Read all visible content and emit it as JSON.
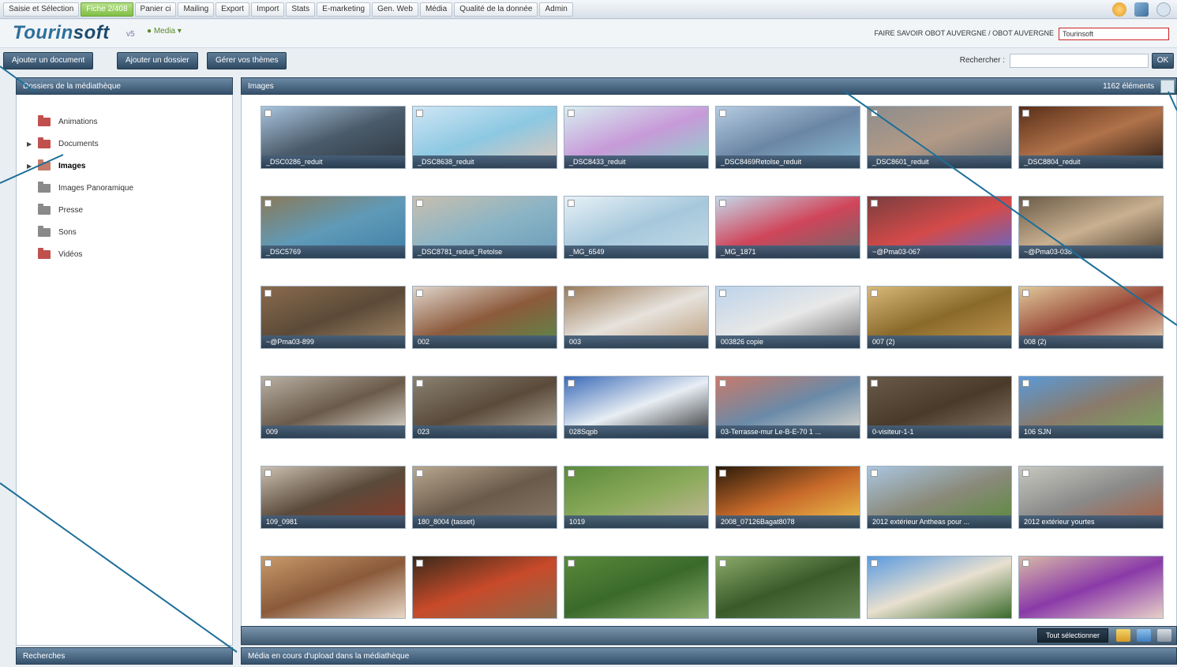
{
  "menubar": {
    "items": [
      "Saisie et Sélection",
      "Fiche 2/408",
      "Panier ci",
      "Mailing",
      "Export",
      "Import",
      "Stats",
      "E-marketing",
      "Gen. Web",
      "Média",
      "Qualité de la donnée",
      "Admin"
    ]
  },
  "brand": {
    "logo_main": "Tourin",
    "logo_soft": "soft",
    "version": "v5",
    "home": "Media",
    "context": "FAIRE SAVOIR OBOT AUVERGNE / OBOT AUVERGNE",
    "context_select": "Tourinsoft"
  },
  "actions": {
    "add_document": "Ajouter un document",
    "add_folder": "Ajouter un dossier",
    "manage_themes": "Gérer vos thèmes",
    "search_label": "Rechercher :",
    "search_value": "",
    "ok": "OK"
  },
  "left_panel": {
    "title": "Dossiers de la médiathèque",
    "folders": [
      {
        "label": "Animations",
        "has_children": false,
        "selected": false,
        "color": "#c0504d"
      },
      {
        "label": "Documents",
        "has_children": true,
        "selected": false,
        "color": "#c0504d"
      },
      {
        "label": "Images",
        "has_children": true,
        "selected": true,
        "color": "#c47b6a"
      },
      {
        "label": "Images Panoramique",
        "has_children": false,
        "selected": false,
        "color": "#8a8a8a"
      },
      {
        "label": "Presse",
        "has_children": false,
        "selected": false,
        "color": "#8a8a8a"
      },
      {
        "label": "Sons",
        "has_children": false,
        "selected": false,
        "color": "#8a8a8a"
      },
      {
        "label": "Vidéos",
        "has_children": false,
        "selected": false,
        "color": "#c0504d"
      }
    ]
  },
  "main_panel": {
    "title": "Images",
    "count": "1162 éléments",
    "tiles": [
      {
        "caption": "_DSC0286_reduit",
        "colors": [
          "#a9c4de",
          "#4a5b6a",
          "#2e3640"
        ]
      },
      {
        "caption": "_DSC8638_reduit",
        "colors": [
          "#cfe6f4",
          "#8cc8e2",
          "#e5c9b9"
        ]
      },
      {
        "caption": "_DSC8433_reduit",
        "colors": [
          "#d8eef0",
          "#c79ad8",
          "#8ad4c9"
        ]
      },
      {
        "caption": "_DSC8469Retolse_reduit",
        "colors": [
          "#b5cbe0",
          "#6b86a5",
          "#8cbfd6"
        ]
      },
      {
        "caption": "_DSC8601_reduit",
        "colors": [
          "#8d8d8d",
          "#b29a86",
          "#6c6e72"
        ]
      },
      {
        "caption": "_DSC8804_reduit",
        "colors": [
          "#5a2f18",
          "#b0724a",
          "#2b1a10"
        ]
      },
      {
        "caption": "_DSC5769",
        "colors": [
          "#8a7a5a",
          "#5f9ab8",
          "#3f7fa6"
        ]
      },
      {
        "caption": "_DSC8781_reduit_Retolse",
        "colors": [
          "#c8bfae",
          "#8bb4c5",
          "#6b9cb8"
        ]
      },
      {
        "caption": "_MG_6549",
        "colors": [
          "#e8f1f6",
          "#a6c8dc",
          "#c5dce8"
        ]
      },
      {
        "caption": "_MG_1871",
        "colors": [
          "#c5d8ea",
          "#d0455a",
          "#6a6a6a"
        ]
      },
      {
        "caption": "~@Pma03-067",
        "colors": [
          "#7a3e3e",
          "#d44a4a",
          "#5a6ad0"
        ]
      },
      {
        "caption": "~@Pma03-038",
        "colors": [
          "#6b5b48",
          "#c9b090",
          "#4d3d2d"
        ]
      },
      {
        "caption": "~@Pma03-899",
        "colors": [
          "#8a6b4d",
          "#5b4a38",
          "#a78a6a"
        ]
      },
      {
        "caption": "002",
        "colors": [
          "#e0d6cc",
          "#8c5a3c",
          "#5a8a4a"
        ]
      },
      {
        "caption": "003",
        "colors": [
          "#9b7a58",
          "#e6e2dc",
          "#b99a78"
        ]
      },
      {
        "caption": "003826 copie",
        "colors": [
          "#bcd3ea",
          "#e8e8e8",
          "#6a6a6a"
        ]
      },
      {
        "caption": "007 (2)",
        "colors": [
          "#d9b979",
          "#8a6a2a",
          "#c49a52"
        ]
      },
      {
        "caption": "008 (2)",
        "colors": [
          "#e0c89a",
          "#9a4a3a",
          "#f0e0c0"
        ]
      },
      {
        "caption": "009",
        "colors": [
          "#b8b0a4",
          "#6a5a4a",
          "#e8e4dc"
        ]
      },
      {
        "caption": "023",
        "colors": [
          "#8a8272",
          "#5a4a3a",
          "#b8b0a0"
        ]
      },
      {
        "caption": "028Sqpb",
        "colors": [
          "#3a6ab8",
          "#e8eef4",
          "#2a2a2a"
        ]
      },
      {
        "caption": "03-Terrasse-mur Le-B-E-70 1 ...",
        "colors": [
          "#c87a6a",
          "#6a8aa8",
          "#e4ded2"
        ]
      },
      {
        "caption": "0-visiteur-1-1",
        "colors": [
          "#6a5a4a",
          "#4a3a2a",
          "#8a7a6a"
        ]
      },
      {
        "caption": "106 SJN",
        "colors": [
          "#5a9ad8",
          "#8a7a6a",
          "#7aa85a"
        ]
      },
      {
        "caption": "109_0981",
        "colors": [
          "#ccc0b2",
          "#5a4a3a",
          "#8a3a2a"
        ]
      },
      {
        "caption": "180_8004 (tasset)",
        "colors": [
          "#b8a890",
          "#6a5a4a",
          "#8a7a6a"
        ]
      },
      {
        "caption": "1019",
        "colors": [
          "#5a8a3a",
          "#8aaa5a",
          "#c8b89a"
        ]
      },
      {
        "caption": "2008_07126Bagat8078",
        "colors": [
          "#2a1a0a",
          "#c86a2a",
          "#f0c850"
        ]
      },
      {
        "caption": "2012 extérieur Antheas pour ...",
        "colors": [
          "#aac6e0",
          "#8a8a7a",
          "#5a8a3a"
        ]
      },
      {
        "caption": "2012 extérieur yourtes",
        "colors": [
          "#c8c8c0",
          "#8a8a8a",
          "#a85a3a"
        ]
      },
      {
        "caption": "",
        "colors": [
          "#c89a6a",
          "#8a5a3a",
          "#e8d8c8"
        ]
      },
      {
        "caption": "",
        "colors": [
          "#3a2a1a",
          "#c84a2a",
          "#8a6a4a"
        ]
      },
      {
        "caption": "",
        "colors": [
          "#5a8a3a",
          "#3a6a2a",
          "#8aaa6a"
        ]
      },
      {
        "caption": "",
        "colors": [
          "#8aaa6a",
          "#3a5a2a",
          "#6a8a5a"
        ]
      },
      {
        "caption": "",
        "colors": [
          "#5a9ae0",
          "#e8e0d0",
          "#3a6a2a"
        ]
      },
      {
        "caption": "",
        "colors": [
          "#d8b8a8",
          "#8a3aa8",
          "#e8d0c8"
        ]
      }
    ]
  },
  "bottom_bar": {
    "select_all": "Tout sélectionner"
  },
  "footer": {
    "search": "Recherches",
    "upload": "Média en cours d'upload dans la médiathèque"
  },
  "accent_color": "#1c6f99"
}
